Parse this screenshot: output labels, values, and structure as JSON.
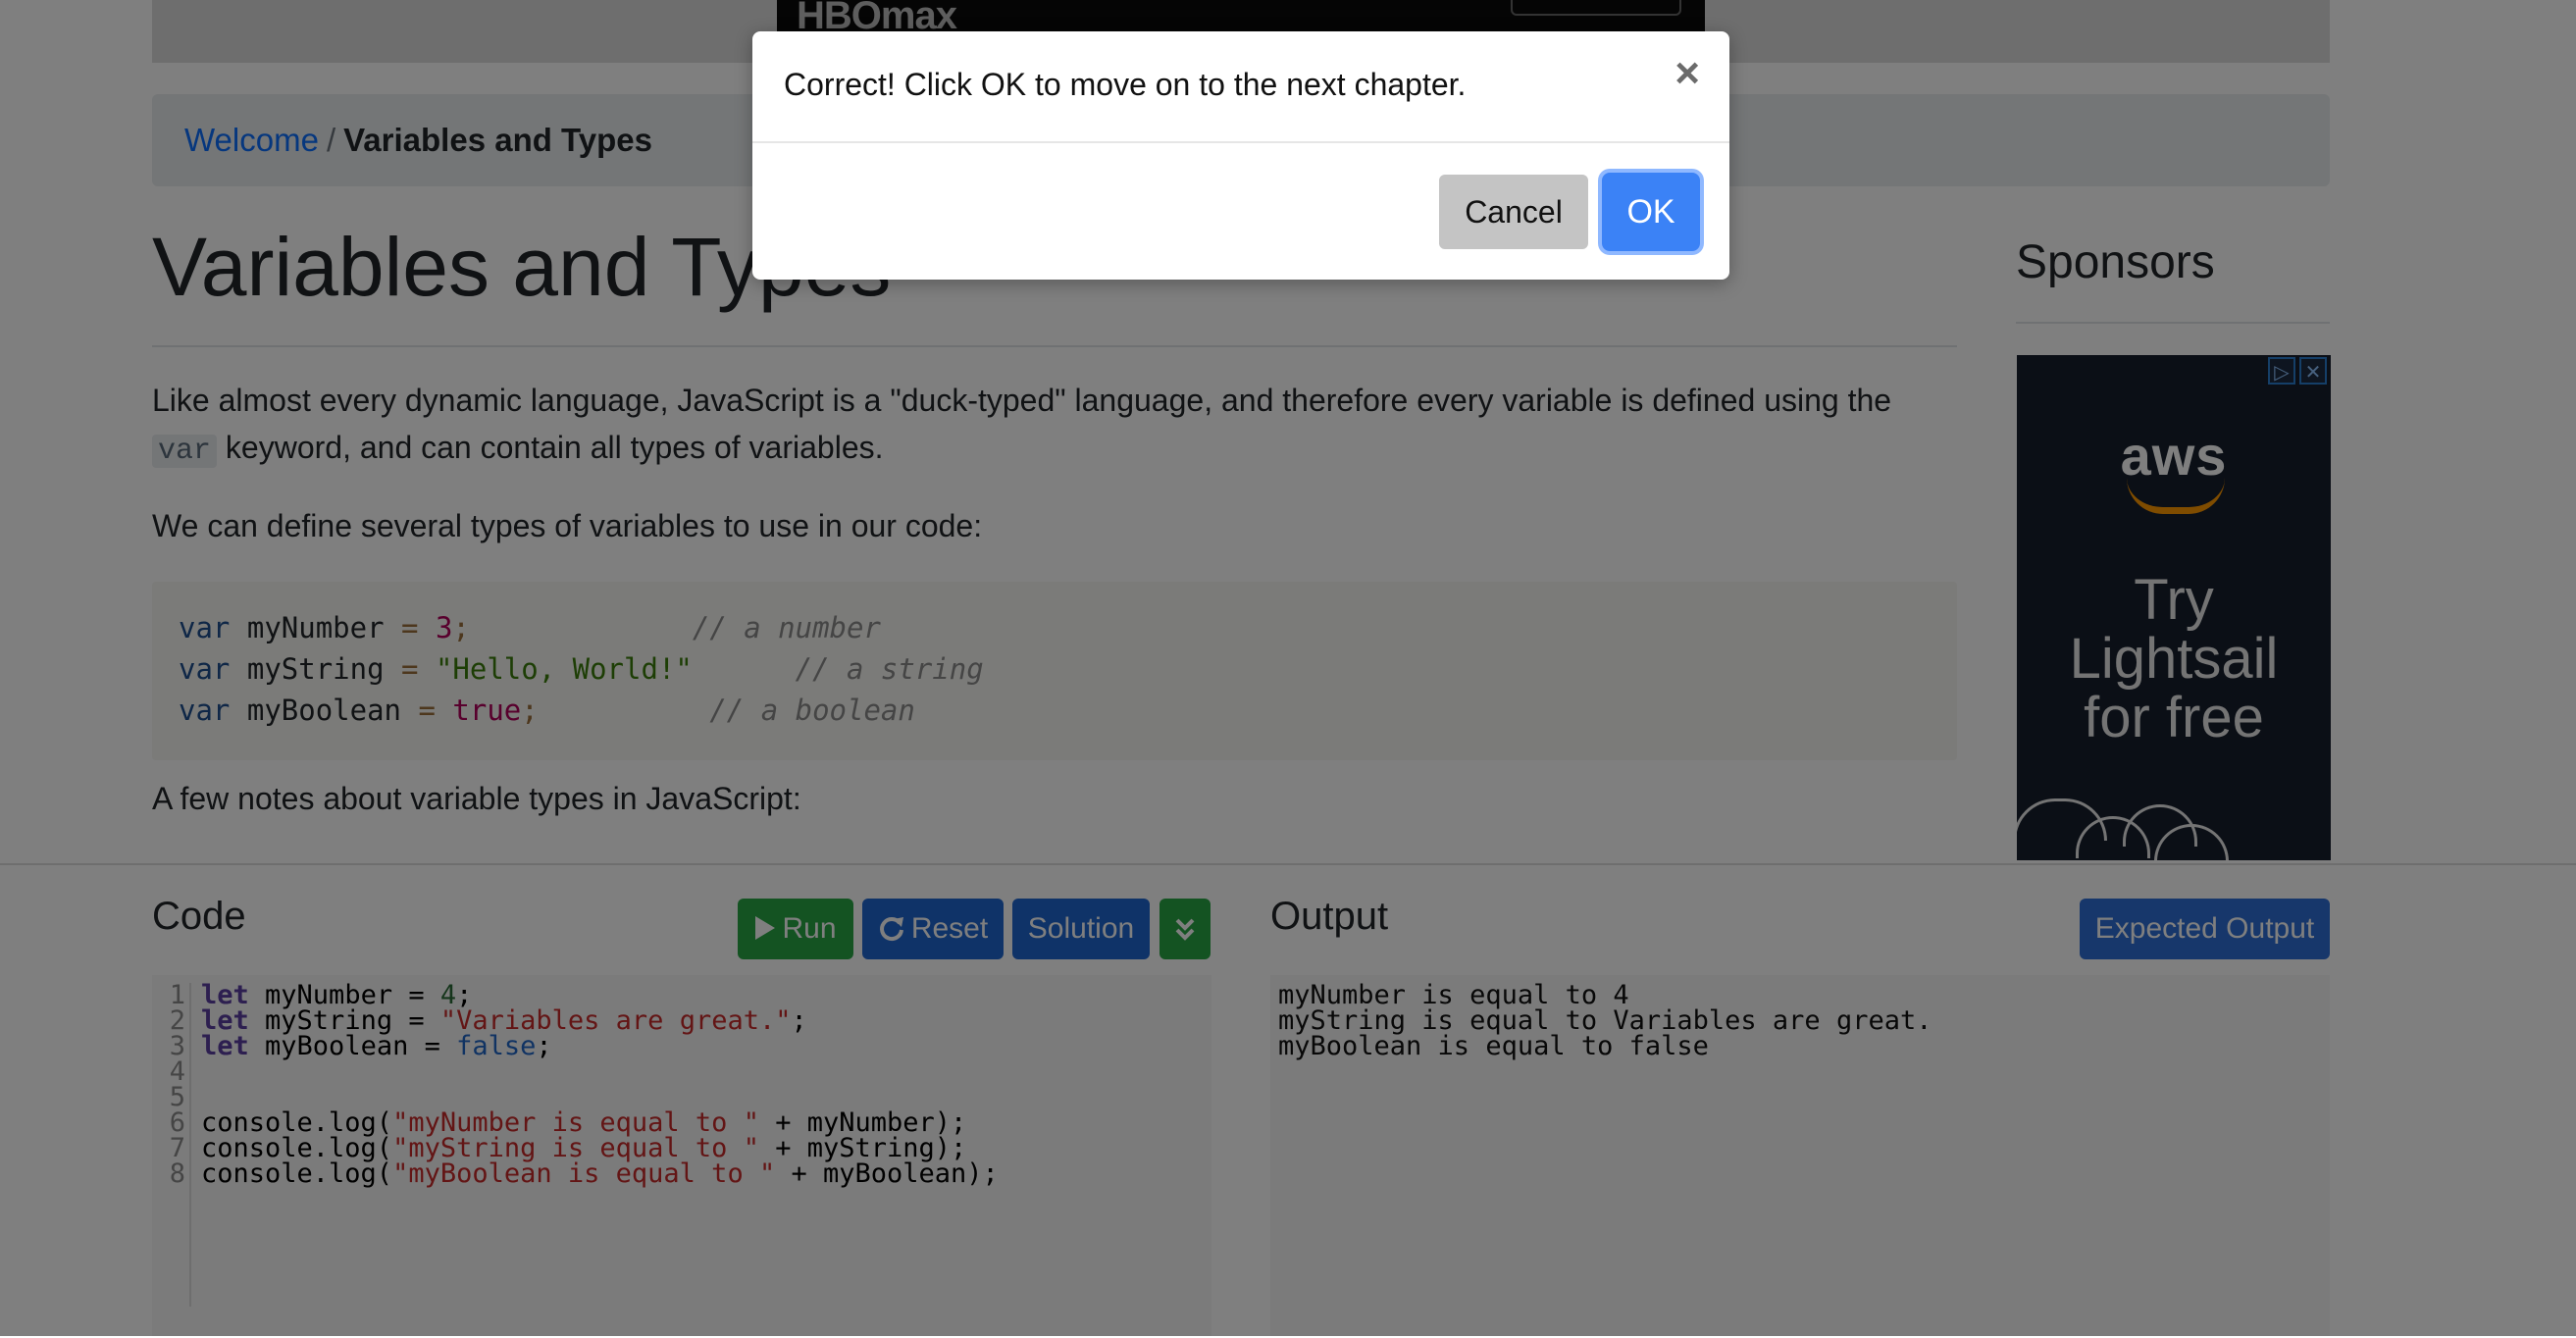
{
  "video": {
    "logo_text": "HBOmax"
  },
  "breadcrumb": {
    "home": "Welcome",
    "separator": "/",
    "current": "Variables and Types"
  },
  "article": {
    "title": "Variables and Types",
    "para1_before": "Like almost every dynamic language, JavaScript is a \"duck-typed\" language, and therefore every variable is defined using the",
    "para1_code": "var",
    "para1_after": "keyword, and can contain all types of variables.",
    "para2": "We can define several types of variables to use in our code:",
    "code_lines": [
      {
        "kw": "var",
        "name": "myNumber",
        "eq": "=",
        "value": "3",
        "value_type": "num",
        "semi": ";",
        "comment": "// a number"
      },
      {
        "kw": "var",
        "name": "myString",
        "eq": "=",
        "value": "\"Hello, World!\"",
        "value_type": "str",
        "semi": "",
        "comment": "// a string"
      },
      {
        "kw": "var",
        "name": "myBoolean",
        "eq": "=",
        "value": "true",
        "value_type": "bool",
        "semi": ";",
        "comment": "// a boolean"
      }
    ],
    "para3": "A few notes about variable types in JavaScript:"
  },
  "sidebar": {
    "title": "Sponsors",
    "ad": {
      "brand": "aws",
      "line1": "Try",
      "line2": "Lightsail",
      "line3": "for free",
      "badge_adchoices": "▷",
      "badge_close": "✕"
    }
  },
  "code_panel": {
    "title": "Code",
    "run_label": "Run",
    "reset_label": "Reset",
    "solution_label": "Solution",
    "expand_icon": "expand-down-icon"
  },
  "editor": {
    "line_numbers": [
      "1",
      "2",
      "3",
      "4",
      "5",
      "6",
      "7",
      "8"
    ],
    "lines": [
      {
        "kw": "let",
        "rest_a": " myNumber = ",
        "lit": "4",
        "lit_type": "num",
        "rest_b": ";"
      },
      {
        "kw": "let",
        "rest_a": " myString = ",
        "lit": "\"Variables are great.\"",
        "lit_type": "str",
        "rest_b": ";"
      },
      {
        "kw": "let",
        "rest_a": " myBoolean = ",
        "lit": "false",
        "lit_type": "atom",
        "rest_b": ";"
      },
      {
        "kw": "",
        "rest_a": "",
        "lit": "",
        "lit_type": "",
        "rest_b": ""
      },
      {
        "kw": "",
        "rest_a": "",
        "lit": "",
        "lit_type": "",
        "rest_b": ""
      },
      {
        "kw": "",
        "rest_a": "console.log(",
        "lit": "\"myNumber is equal to \"",
        "lit_type": "str",
        "rest_b": " + myNumber);"
      },
      {
        "kw": "",
        "rest_a": "console.log(",
        "lit": "\"myString is equal to \"",
        "lit_type": "str",
        "rest_b": " + myString);"
      },
      {
        "kw": "",
        "rest_a": "console.log(",
        "lit": "\"myBoolean is equal to \"",
        "lit_type": "str",
        "rest_b": " + myBoolean);"
      }
    ]
  },
  "output_panel": {
    "title": "Output",
    "expected_label": "Expected Output",
    "lines": [
      "myNumber is equal to 4",
      "myString is equal to Variables are great.",
      "myBoolean is equal to false"
    ]
  },
  "modal": {
    "message": "Correct! Click OK to move on to the next chapter.",
    "close_glyph": "×",
    "cancel_label": "Cancel",
    "ok_label": "OK"
  },
  "colors": {
    "overlay": "rgba(0,0,0,0.5)",
    "ok_button": "#3b82f6",
    "run_button": "#28a745",
    "link": "#0d6efd"
  }
}
